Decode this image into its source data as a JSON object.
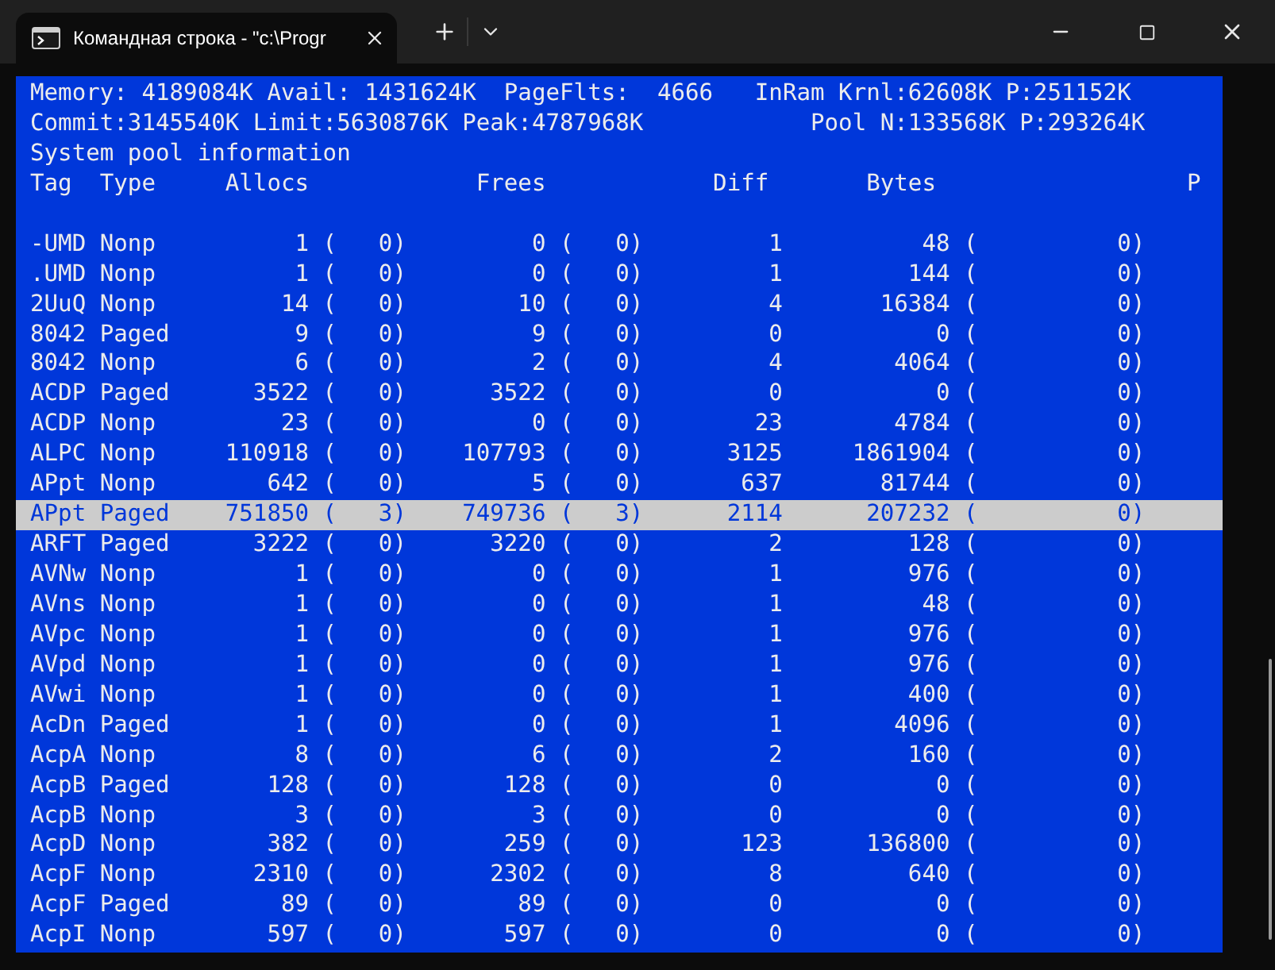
{
  "window": {
    "title": "Командная строка - \"c:\\Progr"
  },
  "console": {
    "status_lines": [
      "Memory: 4189084K Avail: 1431624K  PageFlts:  4666   InRam Krnl:62608K P:251152K",
      "Commit:3145540K Limit:5630876K Peak:4787968K            Pool N:133568K P:293264K",
      "System pool information"
    ],
    "header": "Tag  Type     Allocs            Frees            Diff       Bytes                  P",
    "rows": [
      {
        "cells": [
          "-UMD",
          "Nonp",
          "1",
          "(",
          "0)",
          "0",
          "(",
          "0)",
          "1",
          "48",
          "(",
          "0)"
        ],
        "selected": false
      },
      {
        "cells": [
          ".UMD",
          "Nonp",
          "1",
          "(",
          "0)",
          "0",
          "(",
          "0)",
          "1",
          "144",
          "(",
          "0)"
        ],
        "selected": false
      },
      {
        "cells": [
          "2UuQ",
          "Nonp",
          "14",
          "(",
          "0)",
          "10",
          "(",
          "0)",
          "4",
          "16384",
          "(",
          "0)"
        ],
        "selected": false
      },
      {
        "cells": [
          "8042",
          "Paged",
          "9",
          "(",
          "0)",
          "9",
          "(",
          "0)",
          "0",
          "0",
          "(",
          "0)"
        ],
        "selected": false
      },
      {
        "cells": [
          "8042",
          "Nonp",
          "6",
          "(",
          "0)",
          "2",
          "(",
          "0)",
          "4",
          "4064",
          "(",
          "0)"
        ],
        "selected": false
      },
      {
        "cells": [
          "ACDP",
          "Paged",
          "3522",
          "(",
          "0)",
          "3522",
          "(",
          "0)",
          "0",
          "0",
          "(",
          "0)"
        ],
        "selected": false
      },
      {
        "cells": [
          "ACDP",
          "Nonp",
          "23",
          "(",
          "0)",
          "0",
          "(",
          "0)",
          "23",
          "4784",
          "(",
          "0)"
        ],
        "selected": false
      },
      {
        "cells": [
          "ALPC",
          "Nonp",
          "110918",
          "(",
          "0)",
          "107793",
          "(",
          "0)",
          "3125",
          "1861904",
          "(",
          "0)"
        ],
        "selected": false
      },
      {
        "cells": [
          "APpt",
          "Nonp",
          "642",
          "(",
          "0)",
          "5",
          "(",
          "0)",
          "637",
          "81744",
          "(",
          "0)"
        ],
        "selected": false
      },
      {
        "cells": [
          "APpt",
          "Paged",
          "751850",
          "(",
          "3)",
          "749736",
          "(",
          "3)",
          "2114",
          "207232",
          "(",
          "0)"
        ],
        "selected": true
      },
      {
        "cells": [
          "ARFT",
          "Paged",
          "3222",
          "(",
          "0)",
          "3220",
          "(",
          "0)",
          "2",
          "128",
          "(",
          "0)"
        ],
        "selected": false
      },
      {
        "cells": [
          "AVNw",
          "Nonp",
          "1",
          "(",
          "0)",
          "0",
          "(",
          "0)",
          "1",
          "976",
          "(",
          "0)"
        ],
        "selected": false
      },
      {
        "cells": [
          "AVns",
          "Nonp",
          "1",
          "(",
          "0)",
          "0",
          "(",
          "0)",
          "1",
          "48",
          "(",
          "0)"
        ],
        "selected": false
      },
      {
        "cells": [
          "AVpc",
          "Nonp",
          "1",
          "(",
          "0)",
          "0",
          "(",
          "0)",
          "1",
          "976",
          "(",
          "0)"
        ],
        "selected": false
      },
      {
        "cells": [
          "AVpd",
          "Nonp",
          "1",
          "(",
          "0)",
          "0",
          "(",
          "0)",
          "1",
          "976",
          "(",
          "0)"
        ],
        "selected": false
      },
      {
        "cells": [
          "AVwi",
          "Nonp",
          "1",
          "(",
          "0)",
          "0",
          "(",
          "0)",
          "1",
          "400",
          "(",
          "0)"
        ],
        "selected": false
      },
      {
        "cells": [
          "AcDn",
          "Paged",
          "1",
          "(",
          "0)",
          "0",
          "(",
          "0)",
          "1",
          "4096",
          "(",
          "0)"
        ],
        "selected": false
      },
      {
        "cells": [
          "AcpA",
          "Nonp",
          "8",
          "(",
          "0)",
          "6",
          "(",
          "0)",
          "2",
          "160",
          "(",
          "0)"
        ],
        "selected": false
      },
      {
        "cells": [
          "AcpB",
          "Paged",
          "128",
          "(",
          "0)",
          "128",
          "(",
          "0)",
          "0",
          "0",
          "(",
          "0)"
        ],
        "selected": false
      },
      {
        "cells": [
          "AcpB",
          "Nonp",
          "3",
          "(",
          "0)",
          "3",
          "(",
          "0)",
          "0",
          "0",
          "(",
          "0)"
        ],
        "selected": false
      },
      {
        "cells": [
          "AcpD",
          "Nonp",
          "382",
          "(",
          "0)",
          "259",
          "(",
          "0)",
          "123",
          "136800",
          "(",
          "0)"
        ],
        "selected": false
      },
      {
        "cells": [
          "AcpF",
          "Nonp",
          "2310",
          "(",
          "0)",
          "2302",
          "(",
          "0)",
          "8",
          "640",
          "(",
          "0)"
        ],
        "selected": false
      },
      {
        "cells": [
          "AcpF",
          "Paged",
          "89",
          "(",
          "0)",
          "89",
          "(",
          "0)",
          "0",
          "0",
          "(",
          "0)"
        ],
        "selected": false
      },
      {
        "cells": [
          "AcpI",
          "Nonp",
          "597",
          "(",
          "0)",
          "597",
          "(",
          "0)",
          "0",
          "0",
          "(",
          "0)"
        ],
        "selected": false
      }
    ]
  }
}
